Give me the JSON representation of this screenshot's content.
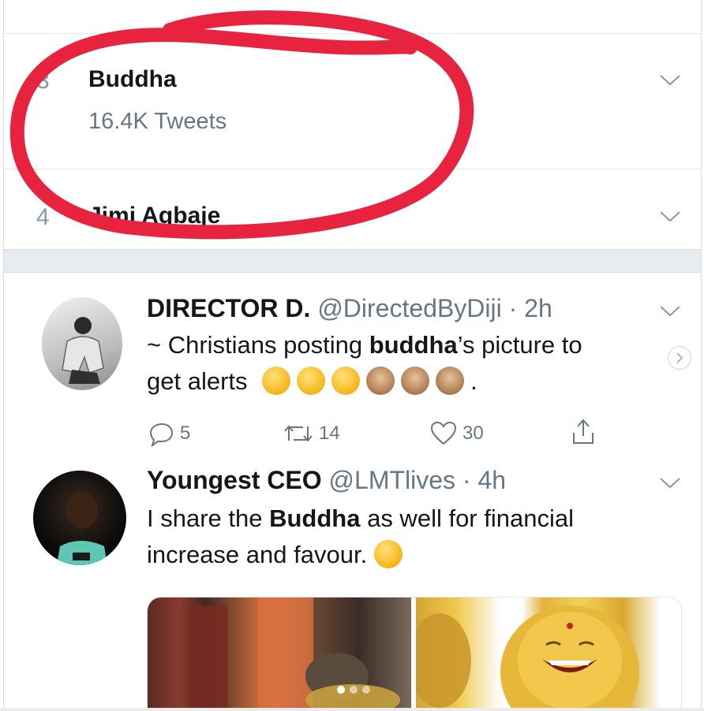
{
  "trends": [
    {
      "rank": "3",
      "name": "Buddha",
      "count": "16.4K Tweets"
    },
    {
      "rank": "4",
      "name": "Jimi Agbaje"
    }
  ],
  "tweets": [
    {
      "name": "DIRECTOR D.",
      "handle": "@DirectedByDiji",
      "sep": "·",
      "time": "2h",
      "text_parts": [
        "~ Christians posting ",
        "buddha",
        "’s picture to",
        "get alerts",
        "."
      ],
      "emojis": [
        "rolling-on-floor-laughing",
        "rolling-on-floor-laughing",
        "rolling-on-floor-laughing",
        "see-no-evil-monkey",
        "see-no-evil-monkey",
        "see-no-evil-monkey"
      ],
      "replies": "5",
      "retweets": "14",
      "likes": "30"
    },
    {
      "name": "Youngest CEO",
      "handle": "@LMTlives",
      "sep": "·",
      "time": "4h",
      "text_parts": [
        "I share the ",
        "Buddha",
        " as well for financial",
        "increase and favour. "
      ],
      "emojis": [
        "winking-face"
      ]
    }
  ],
  "icons": {
    "chevron": "chevron-down-icon",
    "reply": "reply-icon",
    "retweet": "retweet-icon",
    "like": "heart-icon",
    "share": "share-icon",
    "next": "chevron-right-icon"
  },
  "colors": {
    "annotation": "#e8233f",
    "secondary_text": "#657786",
    "divider": "#e1e8ed"
  }
}
